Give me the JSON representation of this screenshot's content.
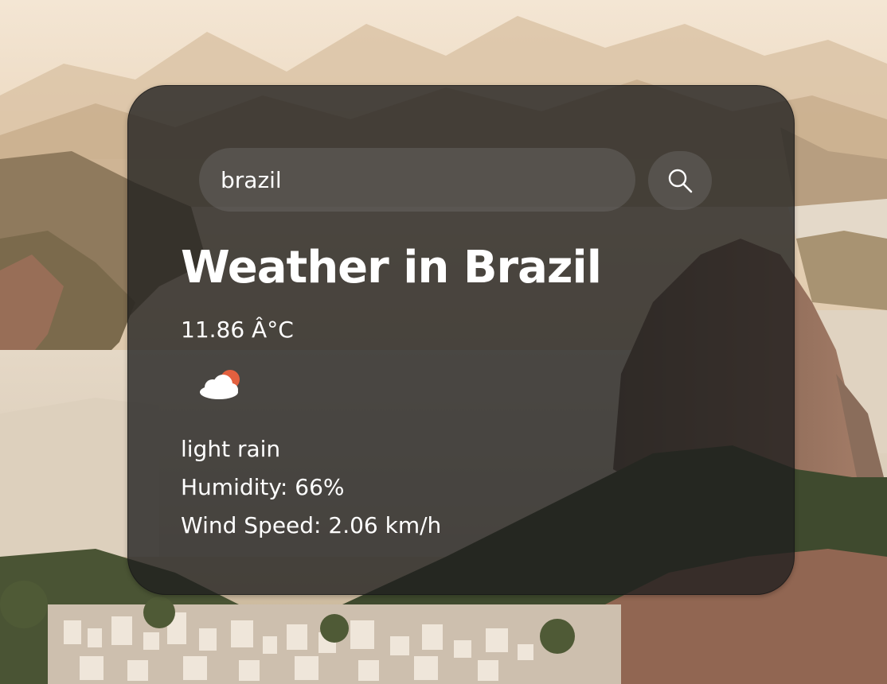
{
  "search": {
    "value": "brazil",
    "button_icon": "search-icon"
  },
  "weather": {
    "title": "Weather in Brazil",
    "temperature": "11.86 Â°C",
    "icon": "cloud-sun-icon",
    "description": "light rain",
    "humidity": "Humidity: 66%",
    "wind": "Wind Speed: 2.06 km/h"
  },
  "colors": {
    "card_background": "#1e1e1e",
    "text": "#ffffff",
    "sun_accent": "#e2603f"
  }
}
